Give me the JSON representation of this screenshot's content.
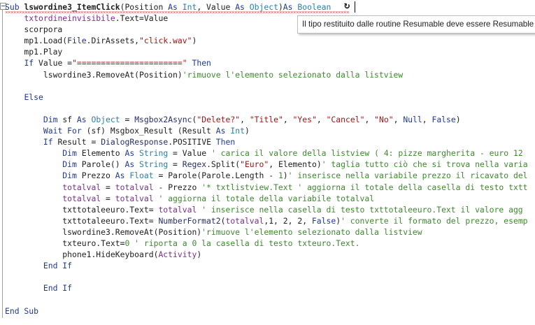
{
  "tooltip": {
    "text": "Il tipo restituito dalle routine Resumable deve essere Resumable"
  },
  "icons": {
    "refresh": "refresh-icon",
    "fold": "collapse-icon"
  },
  "colors": {
    "keyword": "#1f3a93",
    "type": "#2b7fa8",
    "string": "#a31515",
    "comment": "#3c8a2e",
    "variable": "#7b2f8f"
  },
  "code": [
    [
      [
        "kw",
        "Sub "
      ],
      [
        "bold",
        "lswordine3_ItemClick"
      ],
      [
        "",
        "(Position "
      ],
      [
        "kw",
        "As "
      ],
      [
        "ty",
        "Int"
      ],
      [
        "",
        ", Value "
      ],
      [
        "kw",
        "As "
      ],
      [
        "ty",
        "Object"
      ],
      [
        "",
        ")"
      ],
      [
        "kw",
        "As "
      ],
      [
        "ty",
        "Boolean"
      ]
    ],
    [
      [
        "",
        "    "
      ],
      [
        "var",
        "txtordineinvisibile"
      ],
      [
        "",
        ".Text=Value"
      ]
    ],
    [
      [
        "",
        "    scorpora"
      ]
    ],
    [
      [
        "",
        "    mp1.Load("
      ],
      [
        "fn",
        "File"
      ],
      [
        "",
        ".DirAssets,"
      ],
      [
        "str",
        "\"click.wav\""
      ],
      [
        "",
        ")"
      ]
    ],
    [
      [
        "",
        "    mp1.Play"
      ]
    ],
    [
      [
        "",
        "    "
      ],
      [
        "kw",
        "If "
      ],
      [
        "",
        "Value ="
      ],
      [
        "str",
        "\"======================\""
      ],
      [
        "kw",
        " Then"
      ]
    ],
    [
      [
        "",
        "        lswordine3.RemoveAt(Position)"
      ],
      [
        "cm",
        "'rimuove l'elemento selezionato dalla listview"
      ]
    ],
    [
      [
        "",
        ""
      ]
    ],
    [
      [
        "",
        "    "
      ],
      [
        "kw",
        "Else"
      ]
    ],
    [
      [
        "",
        ""
      ]
    ],
    [
      [
        "",
        "        "
      ],
      [
        "kw",
        "Dim "
      ],
      [
        "",
        "sf "
      ],
      [
        "kw",
        "As "
      ],
      [
        "ty",
        "Object"
      ],
      [
        "",
        " = "
      ],
      [
        "fn",
        "Msgbox2Async"
      ],
      [
        "",
        "("
      ],
      [
        "str",
        "\"Delete?\""
      ],
      [
        "",
        ", "
      ],
      [
        "str",
        "\"Title\""
      ],
      [
        "",
        ", "
      ],
      [
        "str",
        "\"Yes\""
      ],
      [
        "",
        ", "
      ],
      [
        "str",
        "\"Cancel\""
      ],
      [
        "",
        ", "
      ],
      [
        "str",
        "\"No\""
      ],
      [
        "",
        ", "
      ],
      [
        "kw",
        "Null"
      ],
      [
        "",
        ", "
      ],
      [
        "kw",
        "False"
      ],
      [
        "",
        ")"
      ]
    ],
    [
      [
        "",
        "        "
      ],
      [
        "kw",
        "Wait For "
      ],
      [
        "",
        "(sf) Msgbox_Result (Result "
      ],
      [
        "kw",
        "As "
      ],
      [
        "ty",
        "Int"
      ],
      [
        "",
        ")"
      ]
    ],
    [
      [
        "",
        "        "
      ],
      [
        "kw",
        "If "
      ],
      [
        "",
        "Result = "
      ],
      [
        "fn",
        "DialogResponse"
      ],
      [
        "",
        ".POSITIVE "
      ],
      [
        "kw",
        "Then"
      ]
    ],
    [
      [
        "",
        "            "
      ],
      [
        "kw",
        "Dim "
      ],
      [
        "",
        "Elemento "
      ],
      [
        "kw",
        "As "
      ],
      [
        "ty",
        "String"
      ],
      [
        "",
        " = Value "
      ],
      [
        "cm",
        "' carica il valore della listview ( 4: pizze margherita - euro 12"
      ]
    ],
    [
      [
        "",
        "            "
      ],
      [
        "kw",
        "Dim "
      ],
      [
        "",
        "Parole() "
      ],
      [
        "kw",
        "As "
      ],
      [
        "ty",
        "String"
      ],
      [
        "",
        " = "
      ],
      [
        "fn",
        "Regex"
      ],
      [
        "",
        ".Split("
      ],
      [
        "str",
        "\"Euro\""
      ],
      [
        "",
        ", Elemento)"
      ],
      [
        "cm",
        "' taglia tutto ciò che si trova nella varia"
      ]
    ],
    [
      [
        "",
        "            "
      ],
      [
        "kw",
        "Dim "
      ],
      [
        "",
        "Prezzo "
      ],
      [
        "kw",
        "As "
      ],
      [
        "ty",
        "Float"
      ],
      [
        "",
        " = Parole(Parole.Length - "
      ],
      [
        "num",
        "1"
      ],
      [
        "",
        ")"
      ],
      [
        "cm",
        "' inserisce nella variabile prezzo il ricavato del"
      ]
    ],
    [
      [
        "",
        "            "
      ],
      [
        "var",
        "totalval"
      ],
      [
        "",
        " = "
      ],
      [
        "var",
        "totalval"
      ],
      [
        "",
        " - Prezzo "
      ],
      [
        "cm",
        "'* txtlistview.Text ' aggiorna il totale della casella di testo txtt"
      ]
    ],
    [
      [
        "",
        "            "
      ],
      [
        "var",
        "totalval"
      ],
      [
        "",
        " = "
      ],
      [
        "var",
        "totalval"
      ],
      [
        "",
        " "
      ],
      [
        "cm",
        "' aggiorna il totale della variabile totalval"
      ]
    ],
    [
      [
        "",
        "            txttotaleeuro.Text= "
      ],
      [
        "var",
        "totalval"
      ],
      [
        "",
        " "
      ],
      [
        "cm",
        "' inserisce nella casella di testo txttotaleeuro.Text il valore agg"
      ]
    ],
    [
      [
        "",
        "            txttotaleeuro.Text= "
      ],
      [
        "fn",
        "NumberFormat2"
      ],
      [
        "",
        "("
      ],
      [
        "var",
        "totalval"
      ],
      [
        "",
        ",1, 2, 2, "
      ],
      [
        "kw",
        "False"
      ],
      [
        "",
        ")"
      ],
      [
        "cm",
        "' converte il formato del prezzo, esemp"
      ]
    ],
    [
      [
        "",
        "            lswordine3.RemoveAt(Position)"
      ],
      [
        "cm",
        "'rimuove l'elemento selezionato dalla listview"
      ]
    ],
    [
      [
        "",
        "            txteuro.Text="
      ],
      [
        "num",
        "0"
      ],
      [
        "",
        " "
      ],
      [
        "cm",
        "' riporta a 0 la casella di testo txteuro.Text."
      ]
    ],
    [
      [
        "",
        "            phone1.HideKeyboard("
      ],
      [
        "var",
        "Activity"
      ],
      [
        "",
        ")"
      ]
    ],
    [
      [
        "",
        "        "
      ],
      [
        "kw",
        "End If"
      ]
    ],
    [
      [
        "",
        ""
      ]
    ],
    [
      [
        "",
        "        "
      ],
      [
        "kw",
        "End If"
      ]
    ],
    [
      [
        "",
        ""
      ]
    ],
    [
      [
        "kw",
        "End Sub"
      ]
    ]
  ]
}
